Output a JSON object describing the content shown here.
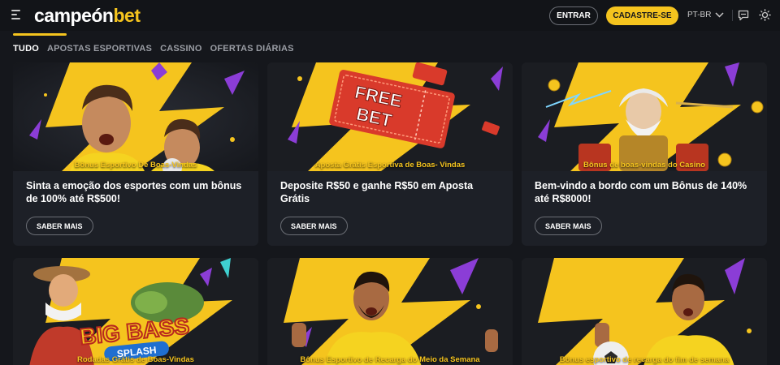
{
  "header": {
    "logo_main": "campeón",
    "logo_accent": "bet",
    "login_label": "ENTRAR",
    "signup_label": "CADASTRE-SE",
    "language": "PT-BR"
  },
  "tabs": [
    {
      "label": "TUDO",
      "active": true
    },
    {
      "label": "APOSTAS ESPORTIVAS",
      "active": false
    },
    {
      "label": "CASSINO",
      "active": false
    },
    {
      "label": "OFERTAS DIÁRIAS",
      "active": false
    }
  ],
  "promotions": [
    {
      "category": "Bônus Esportivo De Boas-Vindas",
      "title": "Sinta a emoção dos esportes com um bônus de 100% até R$500!",
      "button": "SABER MAIS",
      "image": "soccer-players-celebrating"
    },
    {
      "category": "Aposta Grátis Esportiva de Boas- Vindas",
      "title": "Deposite R$50 e ganhe R$50 em Aposta Grátis",
      "button": "SABER MAIS",
      "image": "free-bet-ticket",
      "image_text": [
        "FREE",
        "BET"
      ]
    },
    {
      "category": "Bônus de boas-vindas do Casino",
      "title": "Bem-vindo a bordo com um Bônus de 140% até R$8000!",
      "button": "SABER MAIS",
      "image": "zeus-casino"
    },
    {
      "category": "Rodadas Grátis de Boas-Vindas",
      "image": "big-bass-splash",
      "image_text": [
        "BIG BASS",
        "SPLASH"
      ]
    },
    {
      "category": "Bônus Esportivo de Recarga do Meio da Semana",
      "image": "soccer-player-yellow-jersey"
    },
    {
      "category": "Bônus esportivo de recarga do fim de semana",
      "image": "soccer-player-with-ball"
    }
  ],
  "colors": {
    "accent": "#f5c41e",
    "background": "#15171c",
    "card": "#1d2027"
  }
}
